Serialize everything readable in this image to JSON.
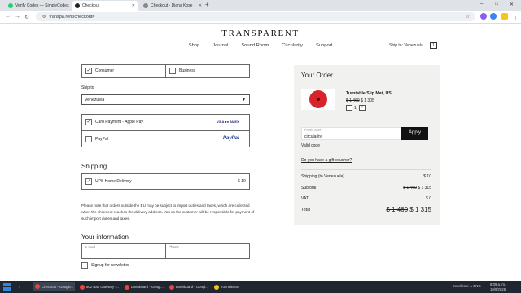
{
  "browser": {
    "tabs": [
      {
        "title": "Verify Codes — SimplyCodes",
        "favicon_color": "#2ecc71"
      },
      {
        "title": "Checkout",
        "favicon_color": "#222222"
      },
      {
        "title": "Checkout - Diana Kose",
        "favicon_color": "#888888"
      }
    ],
    "new_tab": "+",
    "url": "transpa.rent/checkout#",
    "window_controls": [
      "–",
      "□",
      "✕"
    ]
  },
  "site": {
    "logo": "TRANSPARENT",
    "nav": [
      "Shop",
      "Journal",
      "Sound Room",
      "Circularity",
      "Support"
    ],
    "ship_to": "Ship to: Venezuela",
    "cart_count": "1"
  },
  "form": {
    "customer_types": [
      {
        "label": "Consumer",
        "checked": true
      },
      {
        "label": "Business",
        "checked": false
      }
    ],
    "ship_to_label": "Ship to",
    "country": "Venezuela",
    "payments": [
      {
        "label": "Card Payment - Apple Pay",
        "checked": true,
        "badges": "VISA ●● AMEX"
      },
      {
        "label": "PayPal",
        "checked": false,
        "badges": "PayPal"
      }
    ],
    "shipping_heading": "Shipping",
    "shipping_option": {
      "label": "UPS Home Delivery",
      "price": "$ 10",
      "checked": true
    },
    "duties_note": "Please note that orders outside the EU may be subject to import duties and taxes, which are collected when the shipment reaches the delivery address. You as the customer will be responsible for payment of such import duties and taxes.",
    "info_heading": "Your information",
    "email_placeholder": "E-mail",
    "phone_placeholder": "Phone",
    "newsletter_label": "Signup for newsletter"
  },
  "order": {
    "title": "Your Order",
    "item": {
      "name": "Turntable Slip Mat, US,",
      "old_price": "$ 1 460",
      "price": "$ 1 305",
      "qty": "1",
      "minus": "−",
      "plus": "+"
    },
    "promo_placeholder": "Promo code",
    "promo_value": "circularity",
    "apply_label": "Apply",
    "valid_text": "Valid code",
    "gift_link": "Do you have a gift voucher?",
    "summary": [
      {
        "label": "Shipping (to Venezuela)",
        "old": "",
        "value": "$ 10"
      },
      {
        "label": "Subtotal",
        "old": "$ 1 460",
        "value": "$ 1 315"
      },
      {
        "label": "VAT",
        "old": "",
        "value": "$ 0"
      }
    ],
    "total": {
      "label": "Total",
      "old": "$ 1 460",
      "value": "$ 1 315"
    }
  },
  "taskbar": {
    "apps": [
      {
        "label": "Checkout - Google...",
        "color": "#e8453c"
      },
      {
        "label": "502 Bad Gateway -...",
        "color": "#e8453c"
      },
      {
        "label": "Dashboard - Googl...",
        "color": "#e8453c"
      },
      {
        "label": "Dashboard - Googl...",
        "color": "#e8453c"
      },
      {
        "label": "TunnelBear",
        "color": "#f5c518"
      }
    ],
    "tray_text": "Excellente ∧ ENG",
    "time": "8:09 a. m.",
    "date": "10/9/2025"
  }
}
